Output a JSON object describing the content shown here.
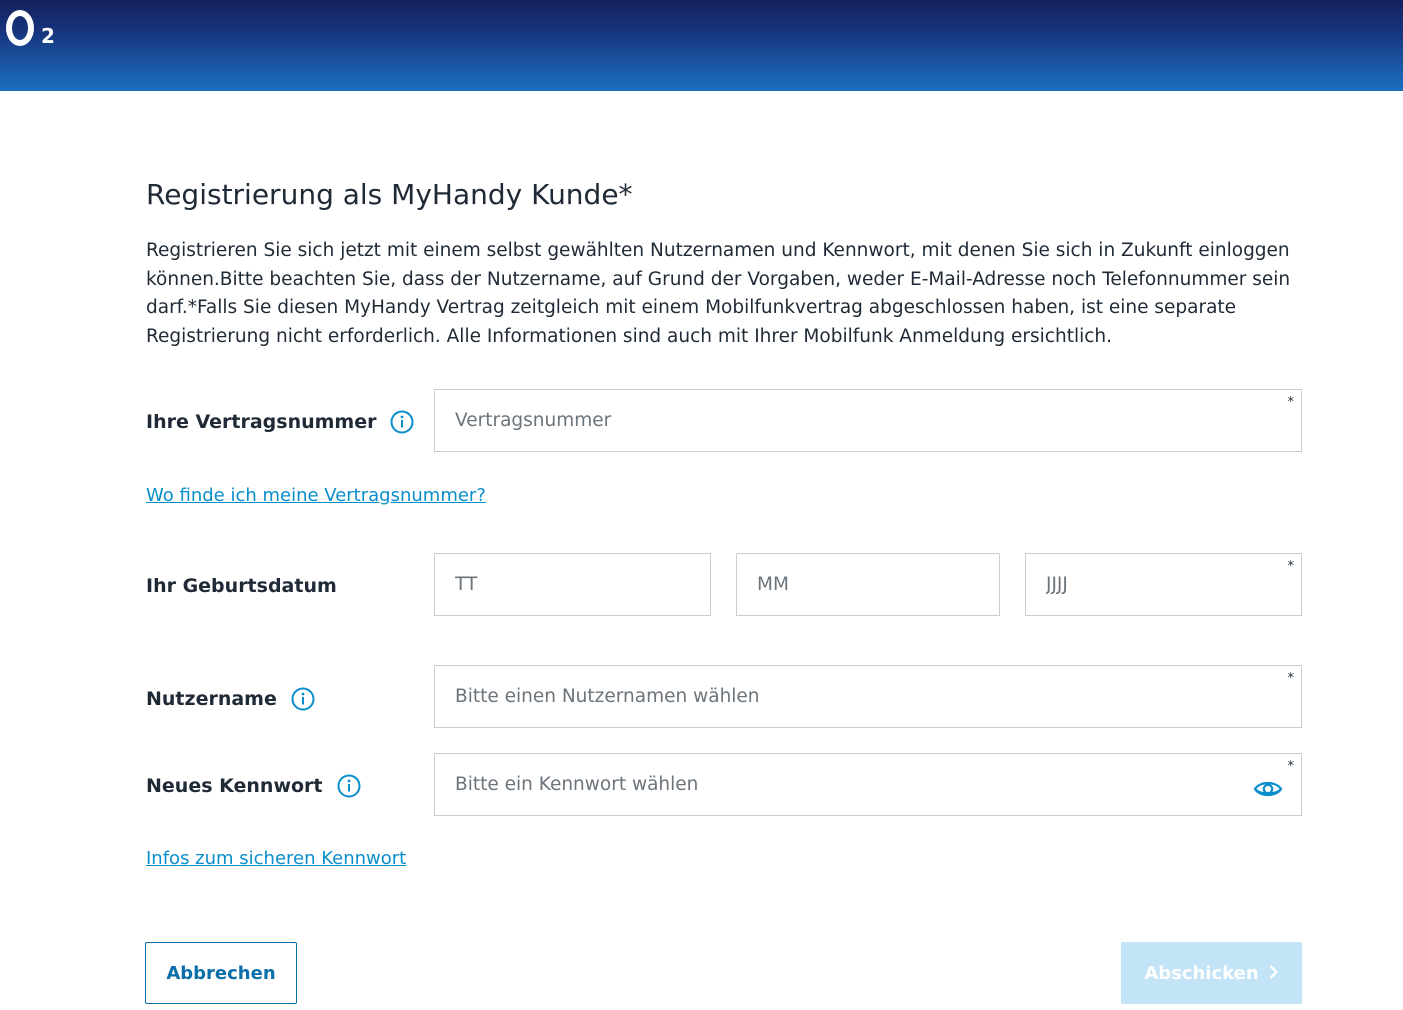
{
  "brand": {
    "logo_letter": "O",
    "logo_subscript": "2"
  },
  "page": {
    "title": "Registrierung als MyHandy Kunde*",
    "intro": "Registrieren Sie sich jetzt mit einem selbst gewählten Nutzernamen und Kennwort, mit denen Sie sich in Zukunft einloggen können.Bitte beachten Sie, dass der Nutzername, auf Grund der Vorgaben, weder E-Mail-Adresse noch Telefonnummer sein darf.*Falls Sie diesen MyHandy Vertrag zeitgleich mit einem Mobilfunkvertrag abgeschlossen haben, ist eine separate Registrierung nicht erforderlich. Alle Informationen sind auch mit Ihrer Mobilfunk Anmeldung ersichtlich."
  },
  "form": {
    "contract": {
      "label": "Ihre Vertragsnummer",
      "placeholder": "Vertragsnummer",
      "value": "",
      "required_mark": "*",
      "help_link": "Wo finde ich meine Vertragsnummer?"
    },
    "birthdate": {
      "label": "Ihr Geburtsdatum",
      "day_placeholder": "TT",
      "month_placeholder": "MM",
      "year_placeholder": "JJJJ",
      "required_mark": "*"
    },
    "username": {
      "label": "Nutzername",
      "placeholder": "Bitte einen Nutzernamen wählen",
      "value": "",
      "required_mark": "*"
    },
    "password": {
      "label": "Neues Kennwort",
      "placeholder": "Bitte ein Kennwort wählen",
      "value": "",
      "required_mark": "*",
      "help_link": "Infos zum sicheren Kennwort"
    }
  },
  "actions": {
    "cancel_label": "Abbrechen",
    "submit_label": "Abschicken",
    "submit_icon": "chevron-right-icon"
  },
  "colors": {
    "header_top": "#14205d",
    "header_bottom": "#1a6fbf",
    "link": "#0a8ecb",
    "icon_accent": "#0a8ecb",
    "cancel_border": "#0a6fa8",
    "submit_disabled_bg": "#c2e4f6",
    "text": "#1f2a36"
  }
}
